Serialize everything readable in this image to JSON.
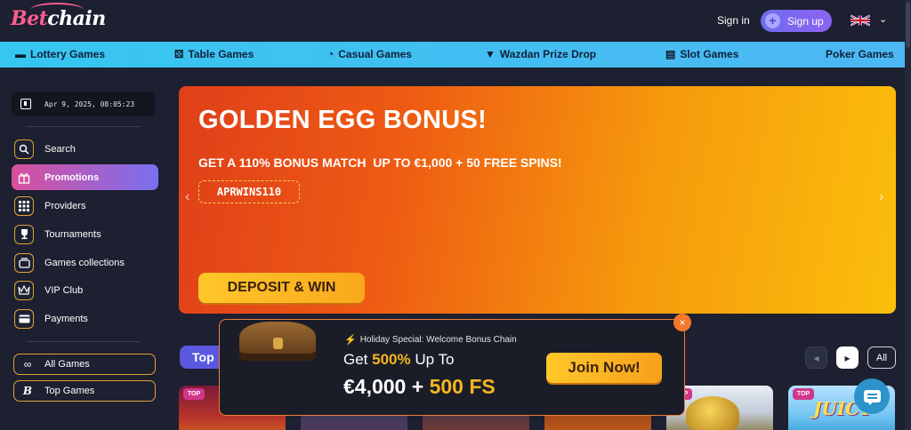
{
  "header": {
    "logo_part1": "Bet",
    "logo_part2": "chain",
    "signin_label": "Sign in",
    "signup_label": "Sign up",
    "language_flag": "uk-flag-icon"
  },
  "categories": [
    {
      "label": "Lottery Games",
      "icon": "ticket-icon"
    },
    {
      "label": "Table Games",
      "icon": "dice-icon"
    },
    {
      "label": "Casual Games",
      "icon": "pacman-icon"
    },
    {
      "label": "Wazdan Prize Drop",
      "icon": "mask-icon"
    },
    {
      "label": "Slot Games",
      "icon": "slot-machine-icon"
    },
    {
      "label": "Poker Games",
      "icon": ""
    }
  ],
  "sidebar": {
    "datetime": "Apr 9, 2025, 08:05:23",
    "items": [
      {
        "label": "Search",
        "icon": "search-icon"
      },
      {
        "label": "Promotions",
        "icon": "gift-icon"
      },
      {
        "label": "Providers",
        "icon": "grid-icon"
      },
      {
        "label": "Tournaments",
        "icon": "trophy-icon"
      },
      {
        "label": "Games collections",
        "icon": "collection-icon"
      },
      {
        "label": "VIP Club",
        "icon": "crown-icon"
      },
      {
        "label": "Payments",
        "icon": "card-icon"
      }
    ],
    "buttons": [
      {
        "label": "All Games",
        "icon": "infinity-icon"
      },
      {
        "label": "Top Games",
        "icon": "b-icon"
      }
    ]
  },
  "banner": {
    "title": "GOLDEN EGG BONUS!",
    "subtitle": "GET A 110% BONUS MATCH  UP TO €1,000 + 50 FREE SPINS!",
    "promo_code": "APRWINS110",
    "cta": "DEPOSIT & WIN"
  },
  "games": {
    "section_label": "Top",
    "all_label": "All",
    "badge": "TOP",
    "card6_title": "JUICY"
  },
  "popup": {
    "kicker": "Holiday Special: Welcome Bonus Chain",
    "line1_prefix": "Get ",
    "line1_accent": "500%",
    "line1_suffix": " Up To",
    "line2_amount": "€4,000 + ",
    "line2_accent": "500 FS",
    "join_label": "Join Now!",
    "close_glyph": "×"
  },
  "colors": {
    "accent_orange": "#f6b51f",
    "brand_purple": "#7b6ff0",
    "category_bar": "#36c7f0"
  }
}
